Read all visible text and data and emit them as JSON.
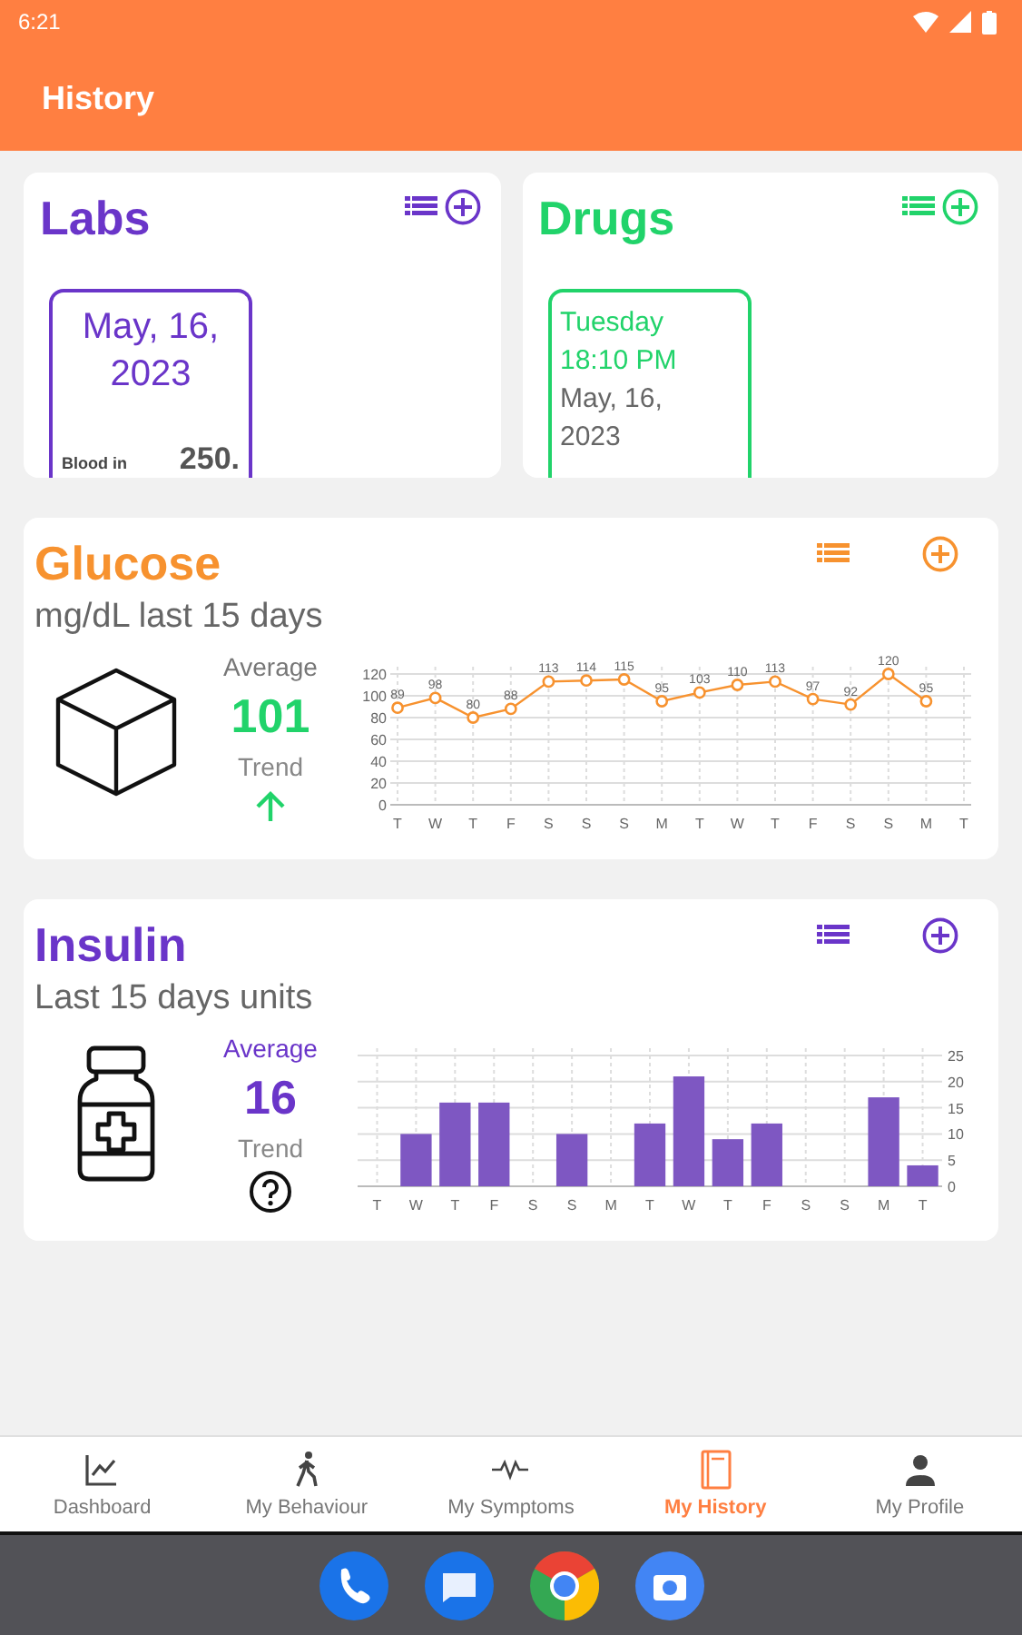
{
  "status_bar": {
    "time": "6:21"
  },
  "app_bar": {
    "title": "History"
  },
  "labs": {
    "title": "Labs",
    "entry": {
      "date": "May, 16, 2023",
      "label": "Blood in",
      "value": "250."
    }
  },
  "drugs": {
    "title": "Drugs",
    "entry": {
      "day": "Tuesday",
      "time": "18:10 PM",
      "date": "May, 16, 2023"
    }
  },
  "glucose": {
    "title": "Glucose",
    "subtitle": "mg/dL last 15 days",
    "average_label": "Average",
    "average": "101",
    "trend": {
      "label": "Trend",
      "kind": "up"
    },
    "chart_data": {
      "type": "line",
      "categories": [
        "T",
        "W",
        "T",
        "F",
        "S",
        "S",
        "S",
        "M",
        "T",
        "W",
        "T",
        "F",
        "S",
        "S",
        "M",
        "T"
      ],
      "ylim": [
        0,
        120
      ],
      "yticks": [
        0,
        20,
        40,
        60,
        80,
        100,
        120
      ],
      "data_labels": true,
      "grid": true,
      "series": [
        {
          "color": "#f7922f",
          "marker": "circle",
          "values": [
            89,
            98,
            80,
            88,
            113,
            114,
            115,
            95,
            103,
            110,
            113,
            97,
            92,
            120,
            95,
            null
          ]
        }
      ]
    }
  },
  "insulin": {
    "title": "Insulin",
    "subtitle": "Last 15 days units",
    "average_label": "Average",
    "average": "16",
    "trend": {
      "label": "Trend",
      "kind": "unknown"
    },
    "chart_data": {
      "type": "bar",
      "categories": [
        "T",
        "W",
        "T",
        "F",
        "S",
        "S",
        "M",
        "T",
        "W",
        "T",
        "F",
        "S",
        "S",
        "M",
        "T"
      ],
      "ylim": [
        0,
        25
      ],
      "yticks": [
        0,
        5,
        10,
        15,
        20,
        25
      ],
      "grid": true,
      "series": [
        {
          "color": "#7e57c2",
          "values": [
            0,
            10,
            16,
            16,
            0,
            10,
            0,
            12,
            21,
            9,
            12,
            0,
            0,
            17,
            4
          ]
        }
      ]
    }
  },
  "bottom_nav": [
    {
      "label": "Dashboard",
      "selected": false
    },
    {
      "label": "My Behaviour",
      "selected": false
    },
    {
      "label": "My Symptoms",
      "selected": false
    },
    {
      "label": "My History",
      "selected": true
    },
    {
      "label": "My Profile",
      "selected": false
    }
  ]
}
